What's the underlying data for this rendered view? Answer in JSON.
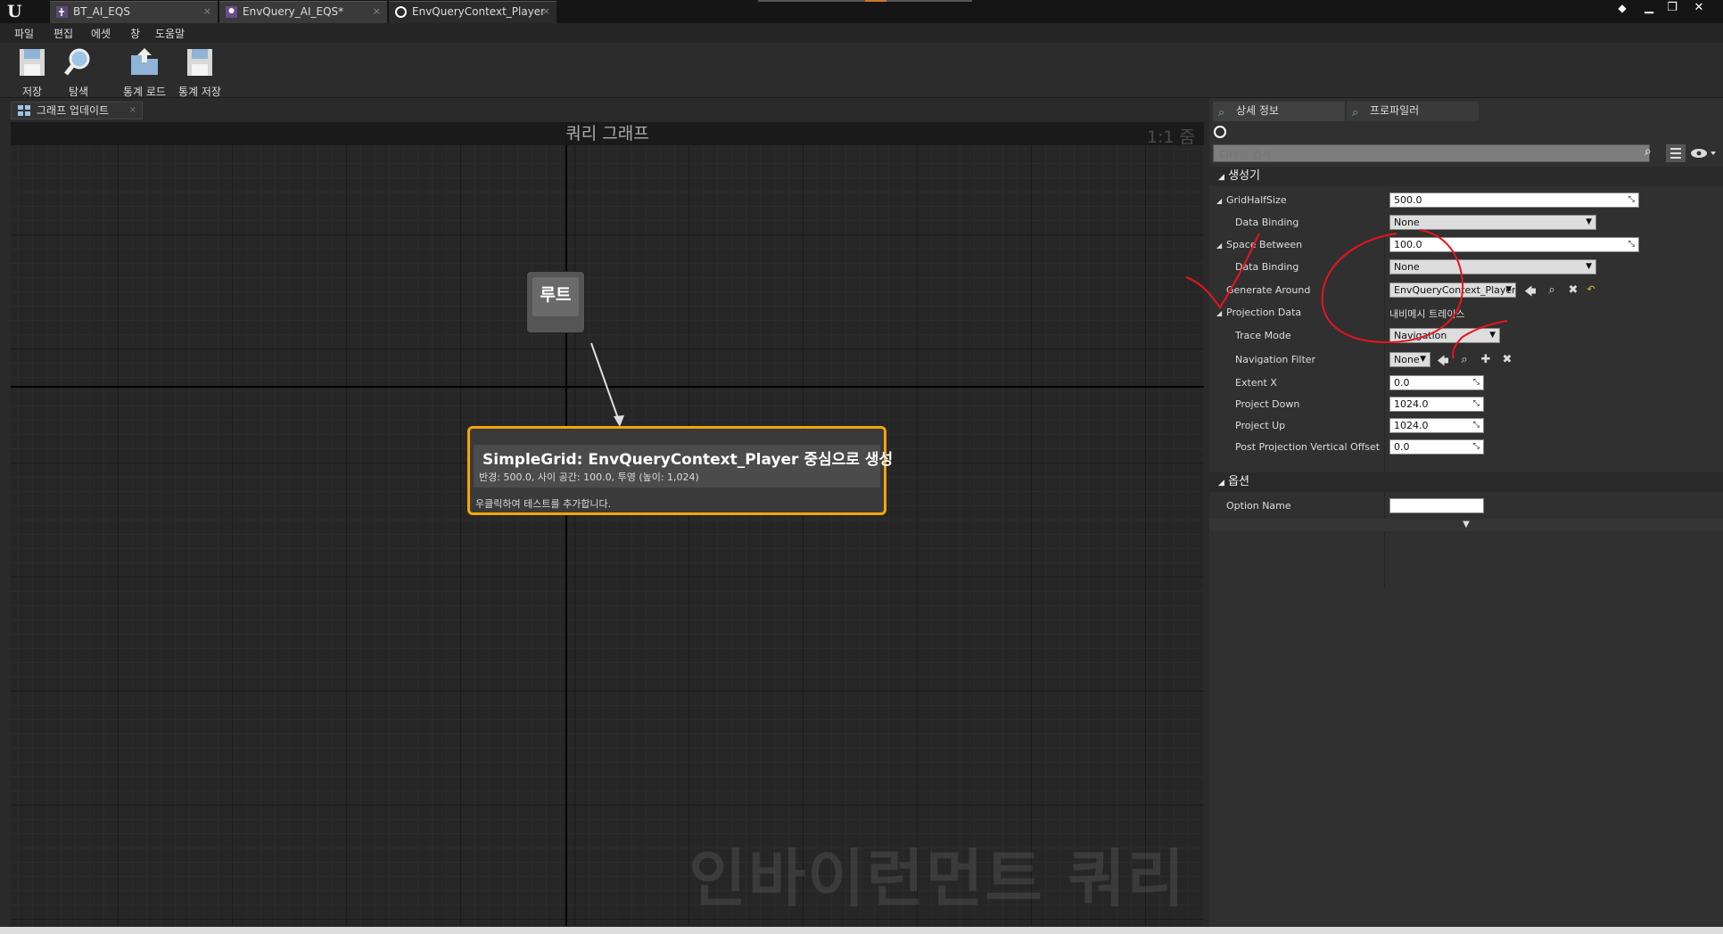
{
  "tabs": [
    {
      "label": "BT_AI_EQS",
      "icon": "behavior-tree-icon"
    },
    {
      "label": "EnvQuery_AI_EQS*",
      "icon": "env-query-icon"
    },
    {
      "label": "EnvQueryContext_Player",
      "icon": "circle-icon"
    }
  ],
  "menu": [
    "파일",
    "편집",
    "에셋",
    "창",
    "도움말"
  ],
  "toolbar": {
    "save_label": "저장",
    "browse_label": "탐색",
    "load_stats_label": "통계 로드",
    "save_stats_label": "통계 저장"
  },
  "graph": {
    "tab_label": "그래프 업데이트",
    "header_title": "쿼리 그래프",
    "zoom": "1:1 줌",
    "watermark": "인바이런먼트 쿼리",
    "root_label": "루트",
    "generator": {
      "title": "SimpleGrid: EnvQueryContext_Player 중심으로 생성",
      "subtitle": "반경: 500.0, 사이 공간: 100.0, 투영 (높이: 1,024)",
      "hint": "우클릭하여 테스트를 추가합니다."
    }
  },
  "details": {
    "tab_details": "상세 정보",
    "tab_profiler": "프로파일러",
    "search_placeholder": "디테일 검색",
    "generator_category": "생성기",
    "options_category": "옵션",
    "props": {
      "grid_half_size": {
        "label": "GridHalfSize",
        "value": "500.0"
      },
      "grid_data_binding": {
        "label": "Data Binding",
        "value": "None"
      },
      "space_between": {
        "label": "Space Between",
        "value": "100.0"
      },
      "space_data_binding": {
        "label": "Data Binding",
        "value": "None"
      },
      "generate_around": {
        "label": "Generate Around",
        "value": "EnvQueryContext_Player"
      },
      "projection_data": {
        "label": "Projection Data",
        "value": "내비메시 트레이스"
      },
      "trace_mode": {
        "label": "Trace Mode",
        "value": "Navigation"
      },
      "navigation_filter": {
        "label": "Navigation Filter",
        "value": "None"
      },
      "extent_x": {
        "label": "Extent X",
        "value": "0.0"
      },
      "project_down": {
        "label": "Project Down",
        "value": "1024.0"
      },
      "project_up": {
        "label": "Project Up",
        "value": "1024.0"
      },
      "post_projection": {
        "label": "Post Projection Vertical Offset",
        "value": "0.0"
      },
      "option_name": {
        "label": "Option Name",
        "value": ""
      }
    }
  },
  "colors": {
    "selection_orange": "#f5a40a",
    "annotation_red": "#e8141e"
  }
}
